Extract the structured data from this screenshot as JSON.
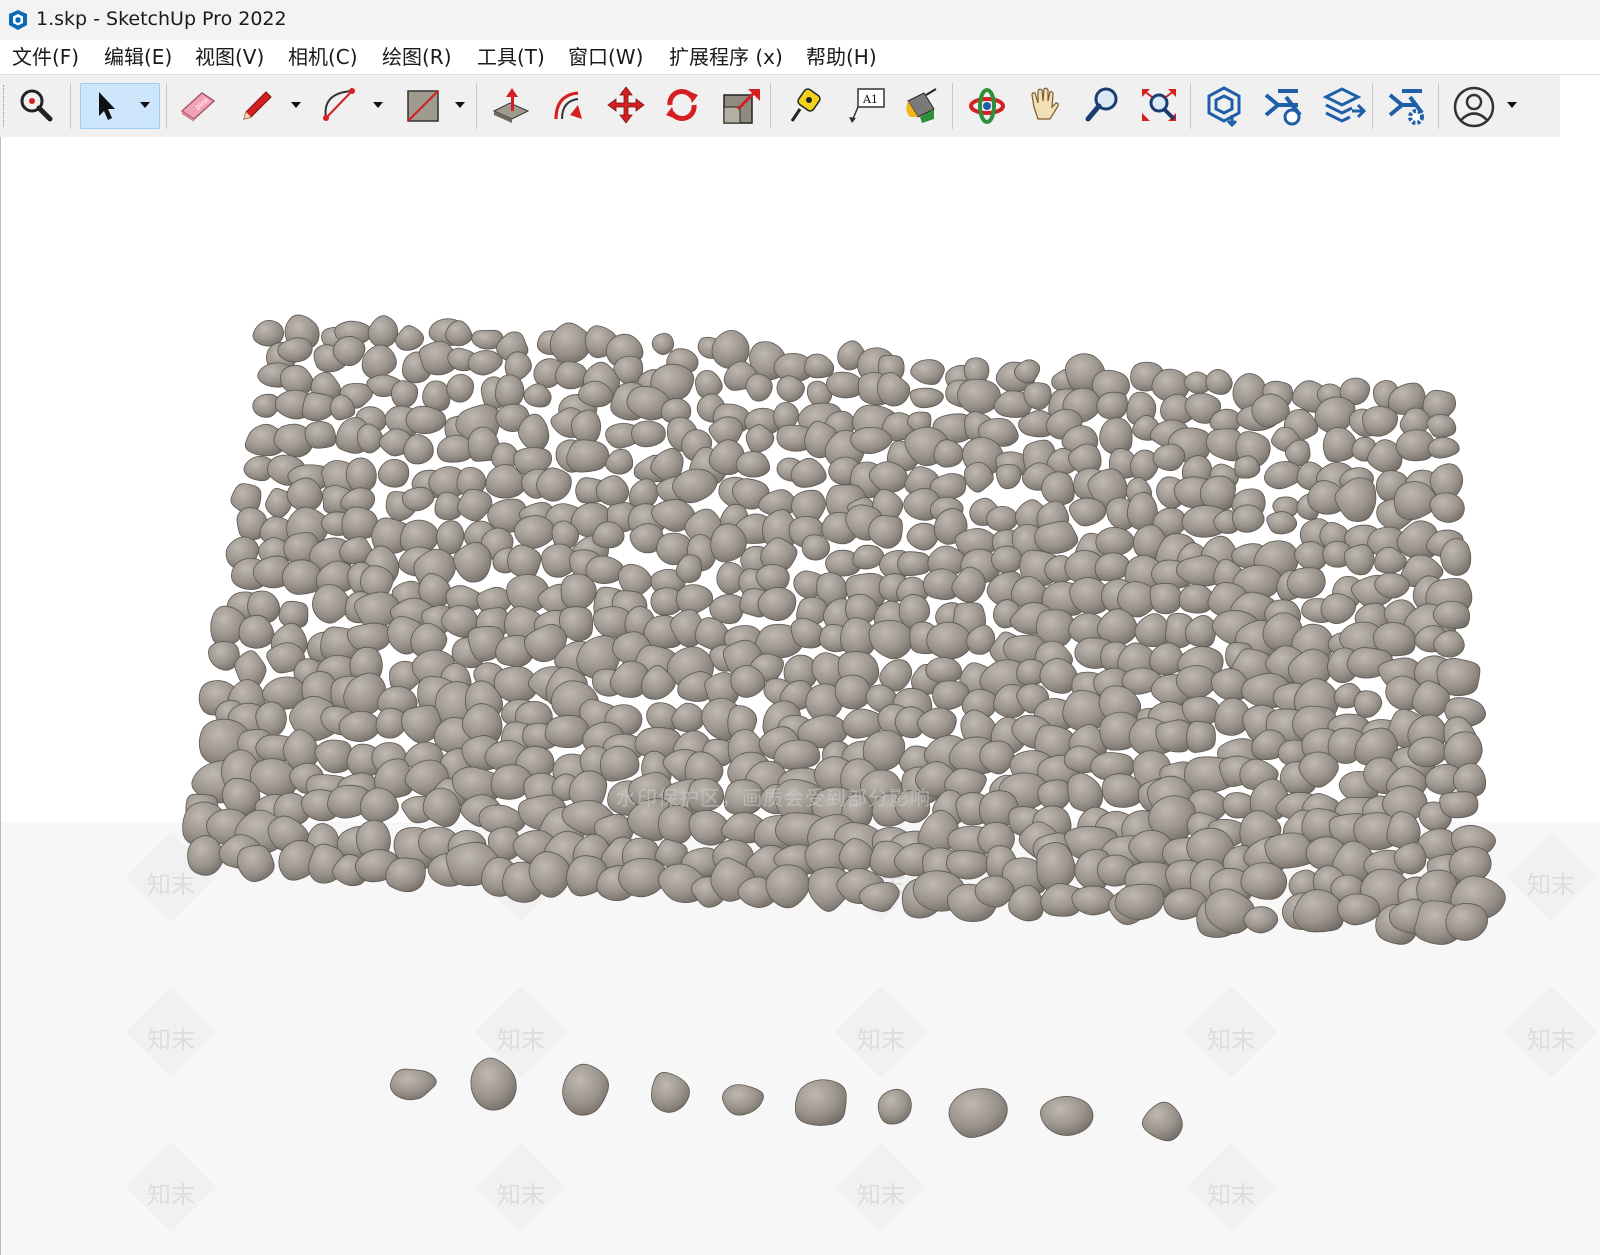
{
  "window": {
    "title": "1.skp - SketchUp Pro 2022"
  },
  "menu": [
    {
      "label": "文件(F)"
    },
    {
      "label": "编辑(E)"
    },
    {
      "label": "视图(V)"
    },
    {
      "label": "相机(C)"
    },
    {
      "label": "绘图(R)"
    },
    {
      "label": "工具(T)"
    },
    {
      "label": "窗口(W)"
    },
    {
      "label": "扩展程序 (x)"
    },
    {
      "label": "帮助(H)"
    }
  ],
  "toolbar": {
    "tools": [
      {
        "name": "zoom-extents",
        "icon": "zoom-extents-icon"
      },
      {
        "name": "select",
        "icon": "arrow-cursor-icon",
        "active": true
      },
      {
        "name": "eraser",
        "icon": "eraser-icon"
      },
      {
        "name": "line",
        "icon": "pencil-icon"
      },
      {
        "name": "arc",
        "icon": "arc-icon"
      },
      {
        "name": "rectangle",
        "icon": "rectangle-icon"
      },
      {
        "name": "push-pull",
        "icon": "push-pull-icon"
      },
      {
        "name": "offset",
        "icon": "offset-icon"
      },
      {
        "name": "move",
        "icon": "move-icon"
      },
      {
        "name": "rotate",
        "icon": "rotate-icon"
      },
      {
        "name": "scale",
        "icon": "scale-icon"
      },
      {
        "name": "tape-measure",
        "icon": "tape-measure-icon"
      },
      {
        "name": "text",
        "icon": "text-label-icon",
        "label": "A1"
      },
      {
        "name": "paint-bucket",
        "icon": "paint-bucket-icon"
      },
      {
        "name": "orbit",
        "icon": "orbit-icon"
      },
      {
        "name": "pan",
        "icon": "hand-icon"
      },
      {
        "name": "zoom",
        "icon": "magnifier-icon"
      },
      {
        "name": "zoom-window",
        "icon": "zoom-window-icon"
      },
      {
        "name": "3d-warehouse",
        "icon": "warehouse-icon"
      },
      {
        "name": "extension-warehouse",
        "icon": "extension-warehouse-icon"
      },
      {
        "name": "layout",
        "icon": "send-to-layout-icon"
      },
      {
        "name": "extension-manager",
        "icon": "extension-manager-icon"
      },
      {
        "name": "account",
        "icon": "user-account-icon"
      }
    ]
  },
  "viewport": {
    "watermark_text": "水印保护区，画质会受到部分影响",
    "watermark_logo_text": "知末",
    "model": "pebble stone field and loose stones"
  },
  "colors": {
    "stone": "#8d8680",
    "stone_highlight": "#b7b1aa",
    "accent_red": "#d42020",
    "accent_blue": "#1f5fa8"
  }
}
